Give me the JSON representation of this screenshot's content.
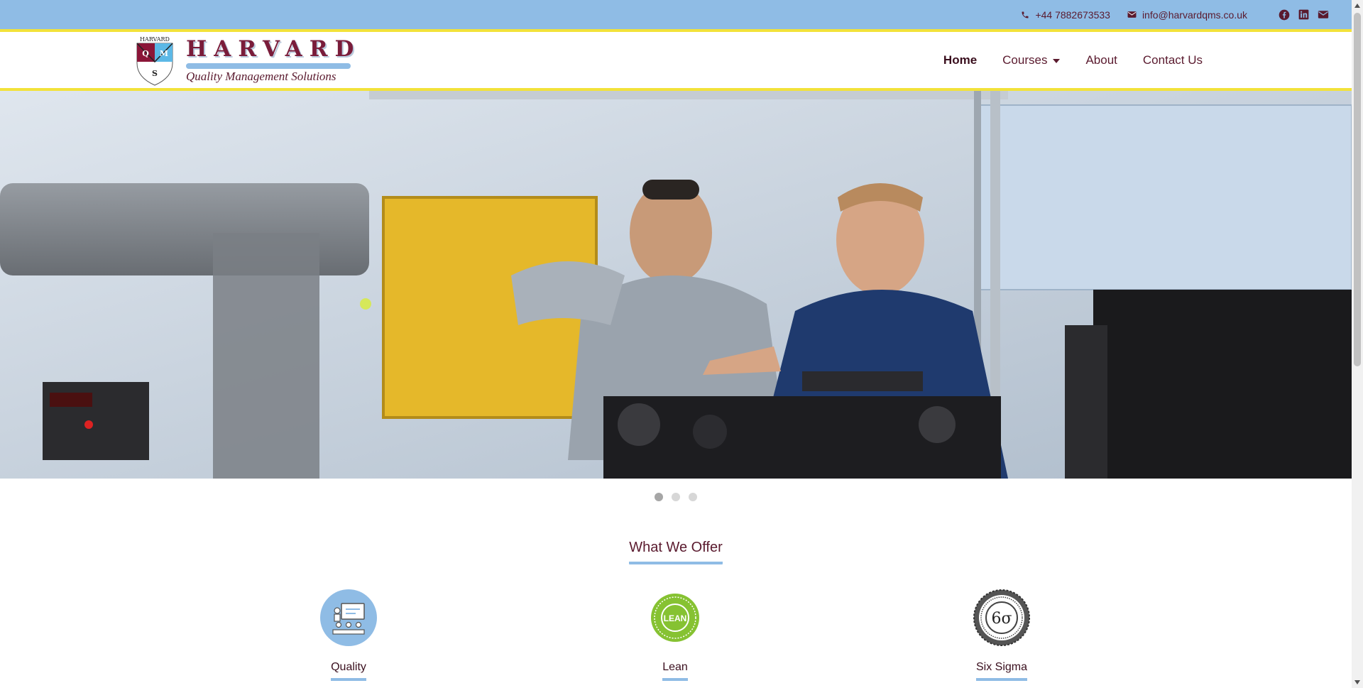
{
  "topbar": {
    "phone": "+44 7882673533",
    "email": "info@harvardqms.co.uk",
    "social_icons": [
      "facebook-icon",
      "linkedin-icon",
      "envelope-icon"
    ]
  },
  "brand": {
    "crest_text": "HARVARD",
    "crest_letters": [
      "Q",
      "M",
      "S"
    ],
    "title": "HARVARD",
    "subtitle": "Quality Management Solutions"
  },
  "nav": {
    "items": [
      {
        "label": "Home",
        "active": true
      },
      {
        "label": "Courses",
        "dropdown": true
      },
      {
        "label": "About"
      },
      {
        "label": "Contact Us"
      }
    ]
  },
  "hero": {
    "slides": 3,
    "active_slide": 1
  },
  "offer": {
    "title": "What We Offer",
    "items": [
      {
        "label": "Quality",
        "icon": "training-presentation-icon"
      },
      {
        "label": "Lean",
        "icon": "lean-badge-icon",
        "badge_text": "LEAN"
      },
      {
        "label": "Six Sigma",
        "icon": "six-sigma-seal-icon",
        "badge_text": "6σ"
      }
    ]
  },
  "colors": {
    "topbar": "#8fbce5",
    "accent_yellow": "#f2e23a",
    "brand_maroon": "#7a1c3a"
  }
}
